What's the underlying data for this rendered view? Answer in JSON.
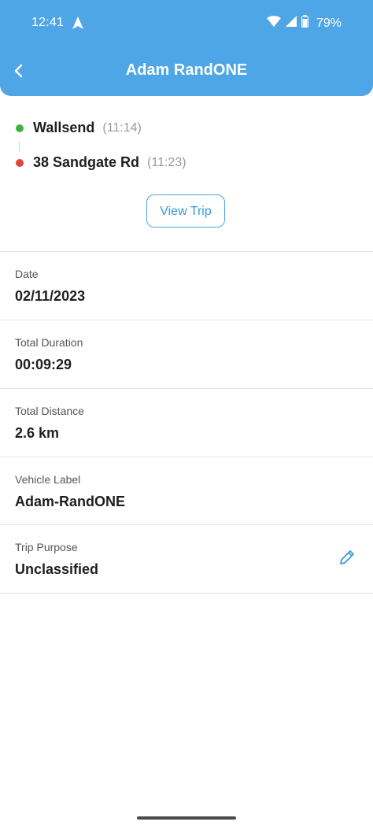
{
  "status_bar": {
    "time": "12:41",
    "battery": "79%"
  },
  "header": {
    "title": "Adam RandONE"
  },
  "trip": {
    "start": {
      "name": "Wallsend",
      "time": "(11:14)",
      "color": "#3db33d"
    },
    "end": {
      "name": "38 Sandgate Rd",
      "time": "(11:23)",
      "color": "#e0443a"
    },
    "view_button": "View Trip"
  },
  "details": [
    {
      "label": "Date",
      "value": "02/11/2023"
    },
    {
      "label": "Total Duration",
      "value": "00:09:29"
    },
    {
      "label": "Total Distance",
      "value": "2.6 km"
    },
    {
      "label": "Vehicle Label",
      "value": "Adam-RandONE"
    },
    {
      "label": "Trip Purpose",
      "value": "Unclassified"
    }
  ],
  "colors": {
    "accent": "#4ea6e6",
    "link": "#3a9ad8"
  }
}
